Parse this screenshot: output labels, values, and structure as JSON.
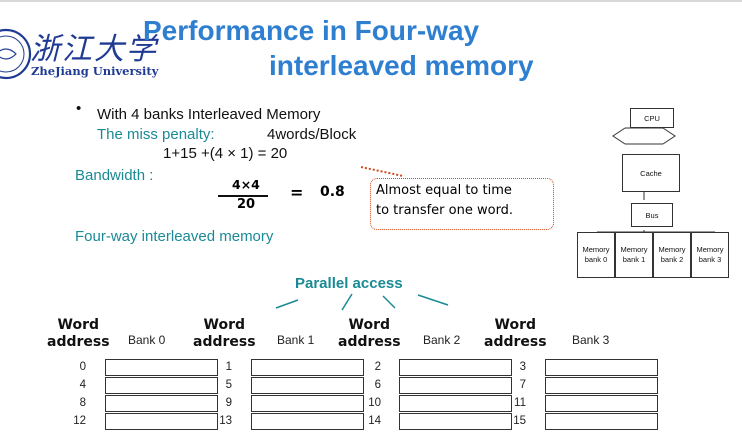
{
  "logo": {
    "chinese": "浙江大学",
    "english": "ZheJiang University"
  },
  "title": {
    "line1": "Performance in Four-way",
    "line2": "interleaved memory"
  },
  "body": {
    "bullet": "•",
    "line1": "With 4 banks Interleaved Memory",
    "miss_label": "The miss penalty:",
    "miss_value": "4words/Block",
    "formula": "1+15 +(4 × 1) = 20",
    "bandwidth_label": "Bandwidth :",
    "frac_num": "4×4",
    "frac_den": "20",
    "frac_eq": "=",
    "frac_result": "0.8",
    "note_line1": "Almost equal to time",
    "note_line2": "to transfer one word.",
    "fourway_label": "Four-way interleaved memory"
  },
  "parallel_label": "Parallel access",
  "diagram": {
    "cpu": "CPU",
    "cache": "Cache",
    "bus": "Bus",
    "memory_banks": [
      {
        "line1": "Memory",
        "line2": "bank 0"
      },
      {
        "line1": "Memory",
        "line2": "bank 1"
      },
      {
        "line1": "Memory",
        "line2": "bank 2"
      },
      {
        "line1": "Memory",
        "line2": "bank 3"
      }
    ]
  },
  "banks": [
    {
      "word_label": "Word",
      "address_label": "address",
      "name": "Bank 0",
      "addresses": [
        "0",
        "4",
        "8",
        "12"
      ]
    },
    {
      "word_label": "Word",
      "address_label": "address",
      "name": "Bank 1",
      "addresses": [
        "1",
        "5",
        "9",
        "13"
      ]
    },
    {
      "word_label": "Word",
      "address_label": "address",
      "name": "Bank 2",
      "addresses": [
        "2",
        "6",
        "10",
        "14"
      ]
    },
    {
      "word_label": "Word",
      "address_label": "address",
      "name": "Bank 3",
      "addresses": [
        "3",
        "7",
        "11",
        "15"
      ]
    }
  ],
  "colors": {
    "title": "#2f7fd0",
    "teal": "#1a8a95",
    "note_border": "#d04a1a",
    "logo": "#1f3a93"
  }
}
